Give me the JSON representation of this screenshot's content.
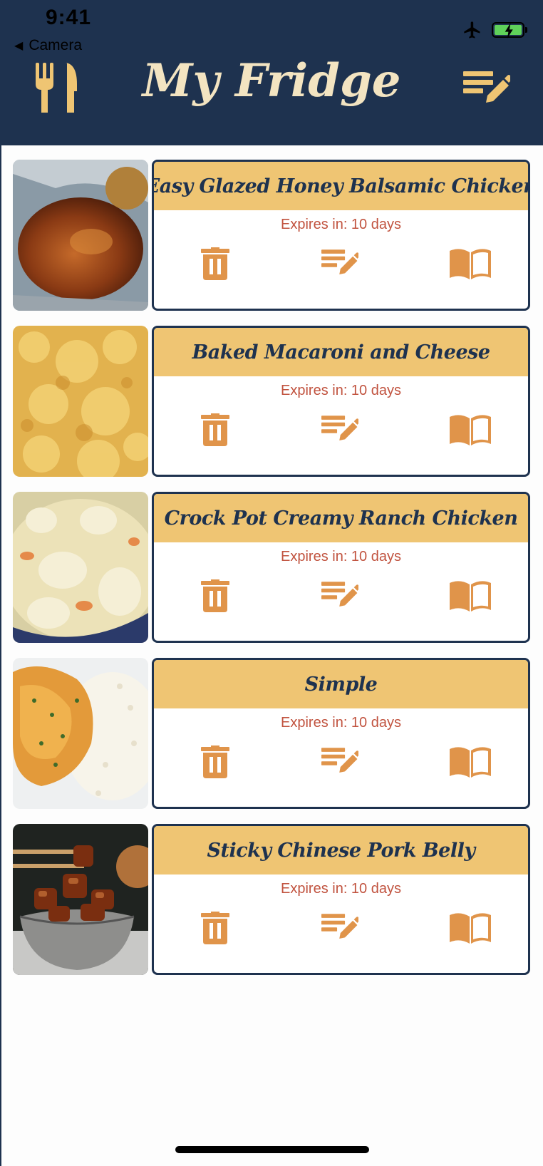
{
  "status_bar": {
    "time": "9:41",
    "back_label": "Camera"
  },
  "header": {
    "title": "My Fridge"
  },
  "colors": {
    "header_bg": "#1e324f",
    "accent": "#efc573",
    "icon": "#e0944a",
    "expiry_text": "#c1533f"
  },
  "recipes": [
    {
      "title": "Easy Glazed Honey Balsamic Chicken",
      "expiry": "Expires in: 10 days",
      "thumb": "roasted-chicken"
    },
    {
      "title": "Baked Macaroni and Cheese",
      "expiry": "Expires in: 10 days",
      "thumb": "mac-and-cheese"
    },
    {
      "title": "Crock Pot Creamy Ranch Chicken",
      "expiry": "Expires in: 10 days",
      "thumb": "creamy-chicken"
    },
    {
      "title": "Simple",
      "expiry": "Expires in: 10 days",
      "thumb": "chicken-curry-rice"
    },
    {
      "title": "Sticky Chinese Pork Belly",
      "expiry": "Expires in: 10 days",
      "thumb": "pork-belly"
    }
  ],
  "icons": {
    "logo": "fork-knife-icon",
    "header_action": "edit-list-icon",
    "delete": "trash-icon",
    "edit": "edit-list-icon",
    "recipe": "book-icon"
  }
}
